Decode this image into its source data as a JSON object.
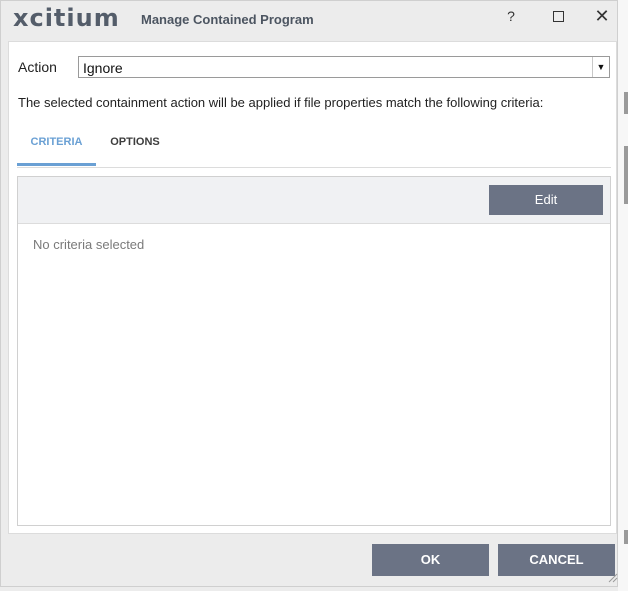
{
  "window": {
    "brand": "xcitium",
    "title": "Manage Contained Program",
    "help_label": "?",
    "maximize_icon": "square-icon",
    "close_label": "✕"
  },
  "action": {
    "label": "Action",
    "selected_value": "Ignore",
    "dropdown_arrow": "▼"
  },
  "description": "The selected containment action will be applied if file properties match the following criteria:",
  "tabs": [
    {
      "label": "CRITERIA",
      "active": true
    },
    {
      "label": "OPTIONS",
      "active": false
    }
  ],
  "criteria": {
    "edit_label": "Edit",
    "empty_text": "No criteria selected"
  },
  "footer": {
    "ok_label": "OK",
    "cancel_label": "CANCEL"
  },
  "colors": {
    "accent_tab": "#6aa0d4",
    "button_bg": "#6b7385",
    "brand_text": "#545d6a"
  }
}
